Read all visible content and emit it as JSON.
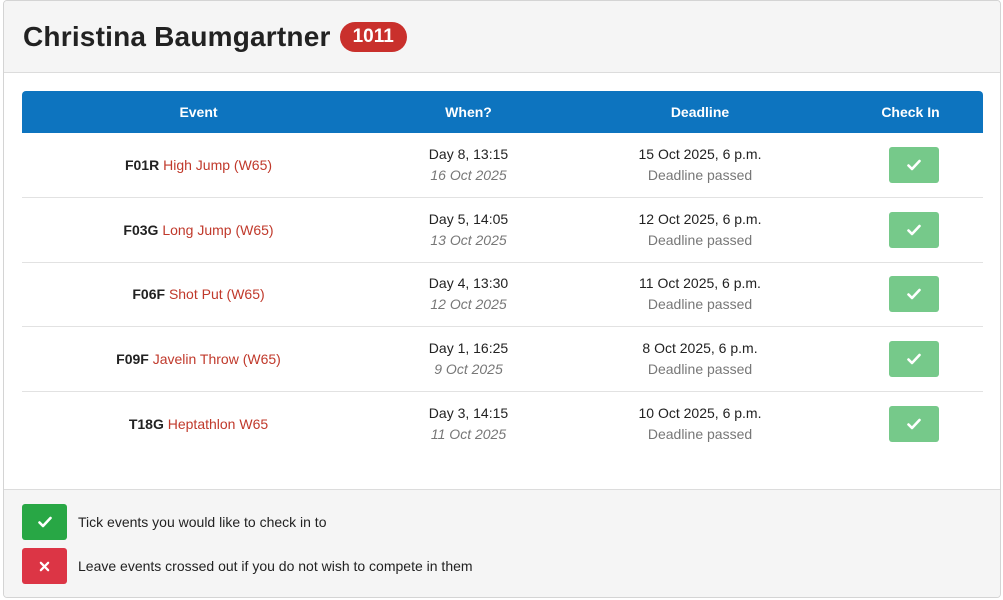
{
  "athlete": {
    "name": "Christina Baumgartner",
    "bib": "1011"
  },
  "table": {
    "headers": {
      "event": "Event",
      "when": "When?",
      "deadline": "Deadline",
      "check_in": "Check In"
    },
    "rows": [
      {
        "code": "F01R",
        "name": "High Jump (W65)",
        "when_day": "Day 8, 13:15",
        "when_date": "16 Oct 2025",
        "deadline": "15 Oct 2025, 6 p.m.",
        "deadline_status": "Deadline passed"
      },
      {
        "code": "F03G",
        "name": "Long Jump (W65)",
        "when_day": "Day 5, 14:05",
        "when_date": "13 Oct 2025",
        "deadline": "12 Oct 2025, 6 p.m.",
        "deadline_status": "Deadline passed"
      },
      {
        "code": "F06F",
        "name": "Shot Put (W65)",
        "when_day": "Day 4, 13:30",
        "when_date": "12 Oct 2025",
        "deadline": "11 Oct 2025, 6 p.m.",
        "deadline_status": "Deadline passed"
      },
      {
        "code": "F09F",
        "name": "Javelin Throw (W65)",
        "when_day": "Day 1, 16:25",
        "when_date": "9 Oct 2025",
        "deadline": "8 Oct 2025, 6 p.m.",
        "deadline_status": "Deadline passed"
      },
      {
        "code": "T18G",
        "name": "Heptathlon W65",
        "when_day": "Day 3, 14:15",
        "when_date": "11 Oct 2025",
        "deadline": "10 Oct 2025, 6 p.m.",
        "deadline_status": "Deadline passed"
      }
    ]
  },
  "legend": {
    "tick_text": "Tick events you would like to check in to",
    "cross_text": "Leave events crossed out if you do not wish to compete in them"
  },
  "colors": {
    "header_blue": "#0d74bf",
    "badge_red": "#c9302c",
    "event_link_red": "#c0392b",
    "check_button_green_disabled": "#76c98a",
    "legend_green": "#28a745",
    "legend_red": "#dc3545"
  },
  "icons": {
    "check_button": "check-icon",
    "legend_tick": "check-icon",
    "legend_cross": "cross-icon"
  }
}
